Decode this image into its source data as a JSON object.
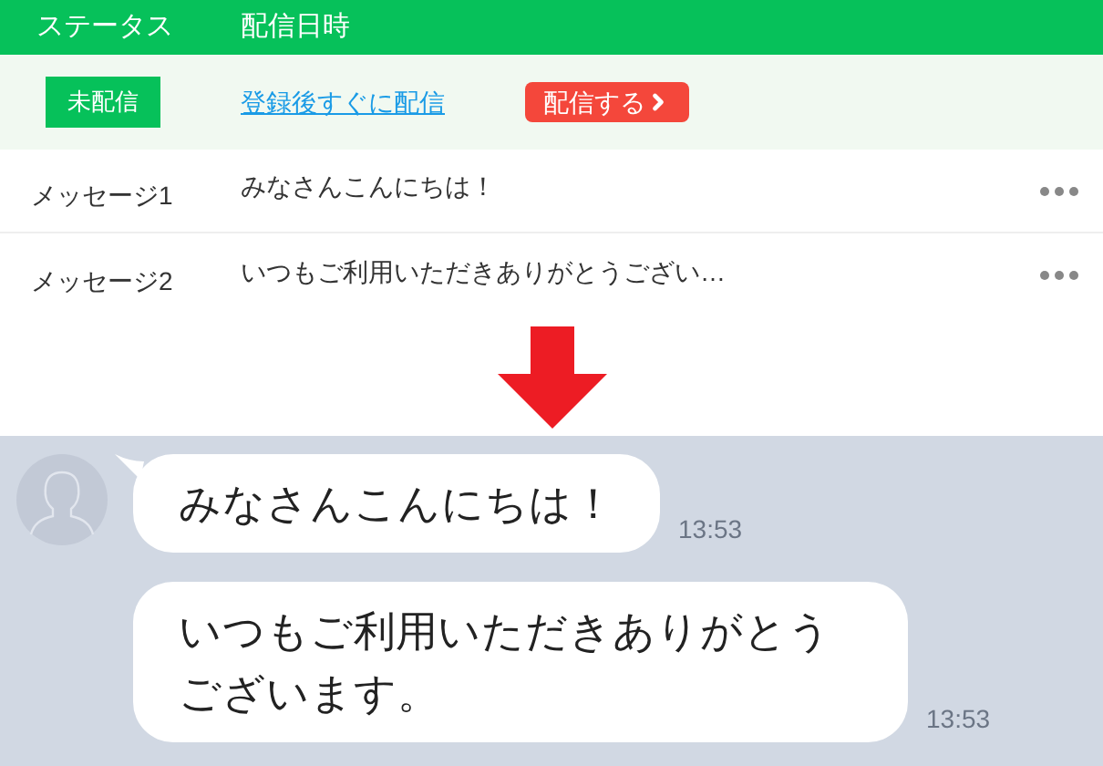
{
  "table": {
    "columns": [
      "ステータス",
      "配信日時"
    ],
    "summary": {
      "status": "未配信",
      "schedule_link": "登録後すぐに配信",
      "send_button": "配信する"
    },
    "rows": [
      {
        "name": "メッセージ1",
        "text": "みなさんこんにちは！"
      },
      {
        "name": "メッセージ2",
        "text": "いつもご利用いただきありがとうござい…"
      }
    ]
  },
  "chat": {
    "messages": [
      {
        "text": "みなさんこんにちは！",
        "time": "13:53",
        "first": true
      },
      {
        "text": "いつもご利用いただきありがとうございます。",
        "time": "13:53",
        "first": false
      }
    ]
  }
}
